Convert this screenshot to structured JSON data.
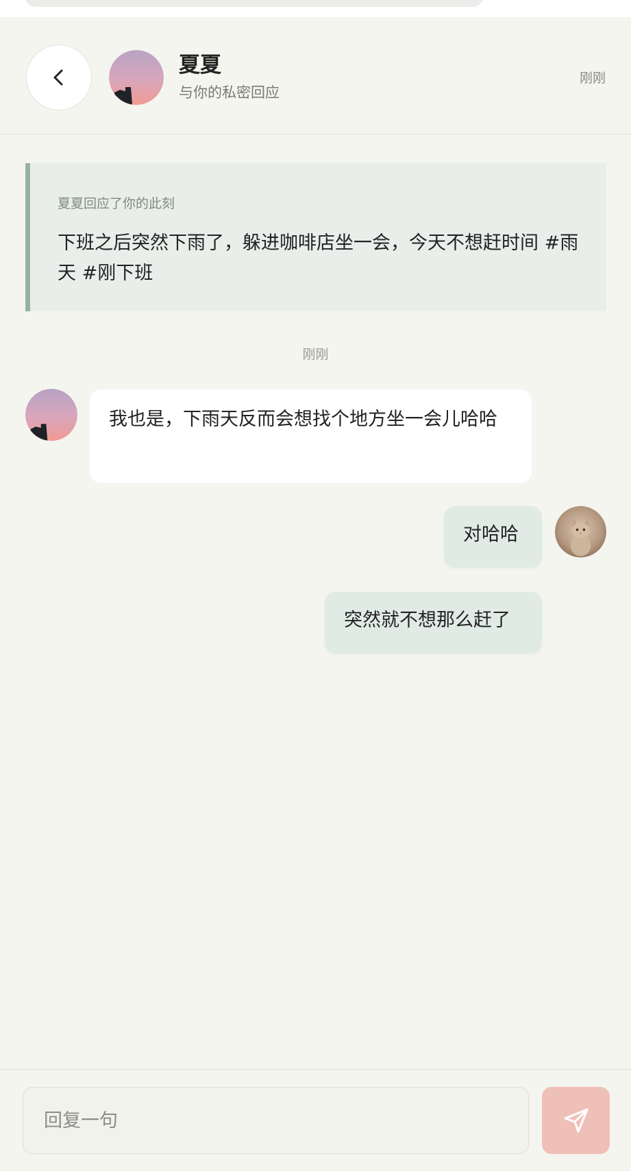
{
  "header": {
    "back_icon": "chevron-left-icon",
    "name": "夏夏",
    "subtitle": "与你的私密回应",
    "time": "刚刚"
  },
  "quote": {
    "caption": "夏夏回应了你的此刻",
    "text": "下班之后突然下雨了，躲进咖啡店坐一会，今天不想赶时间 #雨天 #刚下班"
  },
  "chat": {
    "time_divider": "刚刚",
    "messages": [
      {
        "side": "left",
        "text": "我也是，下雨天反而会想找个地方坐一会儿哈哈"
      },
      {
        "side": "right",
        "text": "对哈哈"
      },
      {
        "side": "right",
        "text": "突然就不想那么赶了"
      }
    ]
  },
  "composer": {
    "placeholder": "回复一句",
    "value": "",
    "send_icon": "send-icon"
  },
  "colors": {
    "background": "#f5f5f0",
    "quote_bg": "#e9eeea",
    "quote_accent": "#95b1a1",
    "my_bubble": "#e0ebe5",
    "their_bubble": "#ffffff",
    "send_button": "#eec0b8"
  }
}
